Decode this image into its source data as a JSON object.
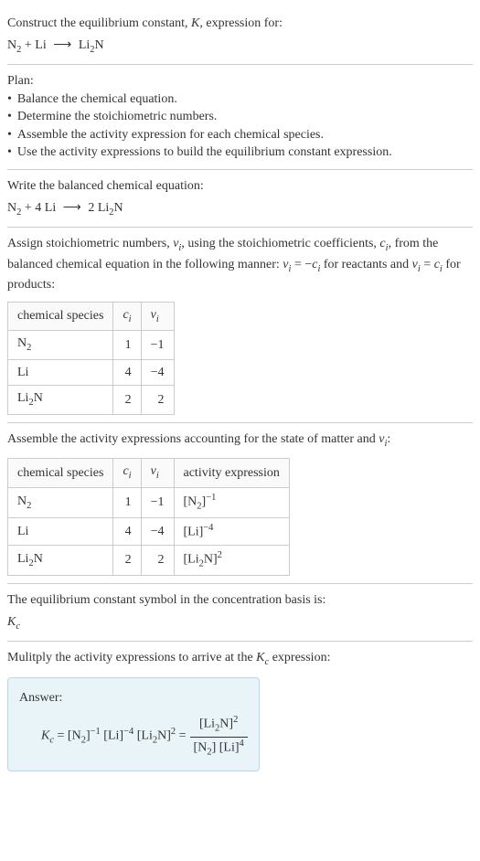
{
  "intro": {
    "line1_prefix": "Construct the equilibrium constant, ",
    "line1_k": "K",
    "line1_suffix": ", expression for:",
    "eq_n2": "N",
    "eq_n2_sub": "2",
    "eq_plus": " + ",
    "eq_li": "Li",
    "eq_arrow": "⟶",
    "eq_li2n_li": "Li",
    "eq_li2n_sub": "2",
    "eq_li2n_n": "N"
  },
  "plan": {
    "title": "Plan:",
    "b1": "Balance the chemical equation.",
    "b2": "Determine the stoichiometric numbers.",
    "b3": "Assemble the activity expression for each chemical species.",
    "b4": "Use the activity expressions to build the equilibrium constant expression.",
    "dot": "•"
  },
  "balanced": {
    "title": "Write the balanced chemical equation:",
    "n2": "N",
    "n2_sub": "2",
    "plus": " + ",
    "coef_li": "4 ",
    "li": "Li",
    "arrow": "⟶",
    "coef_li2n": "2 ",
    "li2n_li": "Li",
    "li2n_sub": "2",
    "li2n_n": "N"
  },
  "stoich": {
    "text_a": "Assign stoichiometric numbers, ",
    "nu": "ν",
    "i": "i",
    "text_b": ", using the stoichiometric coefficients, ",
    "c": "c",
    "text_c": ", from the balanced chemical equation in the following manner: ",
    "eq1_a": " = −",
    "text_d": " for reactants and ",
    "eq2": " = ",
    "text_e": " for products:",
    "h1": "chemical species",
    "h2_c": "c",
    "h2_i": "i",
    "h3_nu": "ν",
    "h3_i": "i",
    "r1_sp_n": "N",
    "r1_sp_sub": "2",
    "r1_c": "1",
    "r1_nu": "−1",
    "r2_sp": "Li",
    "r2_c": "4",
    "r2_nu": "−4",
    "r3_sp_li": "Li",
    "r3_sp_sub": "2",
    "r3_sp_n": "N",
    "r3_c": "2",
    "r3_nu": "2"
  },
  "activity": {
    "text_a": "Assemble the activity expressions accounting for the state of matter and ",
    "nu": "ν",
    "i": "i",
    "text_b": ":",
    "h1": "chemical species",
    "h2_c": "c",
    "h2_i": "i",
    "h3_nu": "ν",
    "h3_i": "i",
    "h4": "activity expression",
    "r1_sp_n": "N",
    "r1_sp_sub": "2",
    "r1_c": "1",
    "r1_nu": "−1",
    "r1_a_open": "[N",
    "r1_a_sub": "2",
    "r1_a_close": "]",
    "r1_a_exp": "−1",
    "r2_sp": "Li",
    "r2_c": "4",
    "r2_nu": "−4",
    "r2_a": "[Li]",
    "r2_a_exp": "−4",
    "r3_sp_li": "Li",
    "r3_sp_sub": "2",
    "r3_sp_n": "N",
    "r3_c": "2",
    "r3_nu": "2",
    "r3_a_open": "[Li",
    "r3_a_sub": "2",
    "r3_a_close": "N]",
    "r3_a_exp": "2"
  },
  "symbol": {
    "text": "The equilibrium constant symbol in the concentration basis is:",
    "k": "K",
    "c": "c"
  },
  "multiply": {
    "text_a": "Mulitply the activity expressions to arrive at the ",
    "k": "K",
    "c": "c",
    "text_b": " expression:"
  },
  "answer": {
    "label": "Answer:",
    "k": "K",
    "c": "c",
    "eq": " = ",
    "t1_open": "[N",
    "t1_sub": "2",
    "t1_close": "]",
    "t1_exp": "−1",
    "sp": " ",
    "t2": "[Li]",
    "t2_exp": "−4",
    "t3_open": "[Li",
    "t3_sub": "2",
    "t3_close": "N]",
    "t3_exp": "2",
    "eq2": " = ",
    "num_open": "[Li",
    "num_sub": "2",
    "num_close": "N]",
    "num_exp": "2",
    "den1_open": "[N",
    "den1_sub": "2",
    "den1_close": "]",
    "den_sp": " ",
    "den2": "[Li]",
    "den2_exp": "4"
  }
}
